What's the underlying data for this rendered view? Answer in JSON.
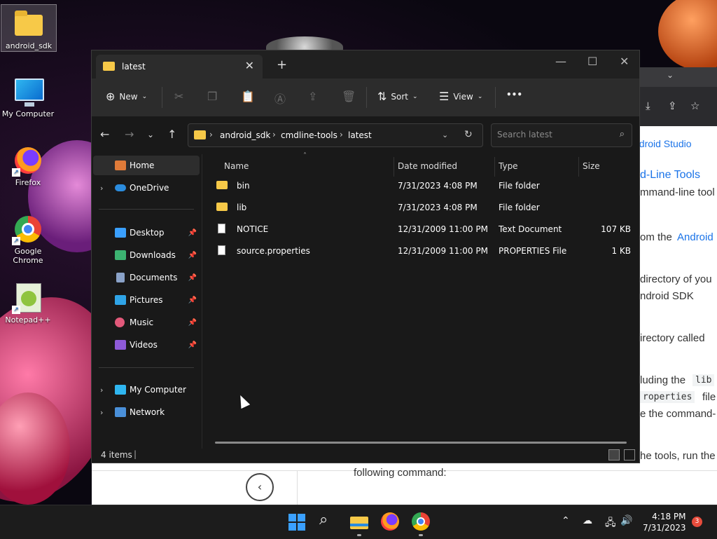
{
  "desktop": {
    "icons": [
      {
        "label": "android_sdk"
      },
      {
        "label": "My Computer"
      },
      {
        "label": "Firefox"
      },
      {
        "label": "Google Chrome"
      },
      {
        "label": "Notepad++"
      }
    ]
  },
  "browser": {
    "lines": [
      "ndroid Studio",
      "d-Line Tools",
      "mmand-line tool",
      "om the ",
      "Android",
      "directory of you",
      "ndroid SDK",
      "irectory called",
      "luding the",
      "lib",
      "roperties",
      "file",
      "e the command-",
      "he tools, run the",
      "following command:"
    ]
  },
  "explorer": {
    "tab_title": "latest",
    "new_tab": "+",
    "toolbar": {
      "new_label": "New",
      "sort_label": "Sort",
      "view_label": "View",
      "more_label": "•••"
    },
    "breadcrumb": [
      "android_sdk",
      "cmdline-tools",
      "latest"
    ],
    "search_placeholder": "Search latest",
    "nav": {
      "home": "Home",
      "onedrive": "OneDrive",
      "desktop": "Desktop",
      "downloads": "Downloads",
      "documents": "Documents",
      "pictures": "Pictures",
      "music": "Music",
      "videos": "Videos",
      "my_computer": "My Computer",
      "network": "Network"
    },
    "columns": {
      "name": "Name",
      "date": "Date modified",
      "type": "Type",
      "size": "Size"
    },
    "files": [
      {
        "name": "bin",
        "date": "7/31/2023 4:08 PM",
        "type": "File folder",
        "size": "",
        "icon": "folder-icon"
      },
      {
        "name": "lib",
        "date": "7/31/2023 4:08 PM",
        "type": "File folder",
        "size": "",
        "icon": "folder-icon"
      },
      {
        "name": "NOTICE",
        "date": "12/31/2009 11:00 PM",
        "type": "Text Document",
        "size": "107 KB",
        "icon": "document-icon"
      },
      {
        "name": "source.properties",
        "date": "12/31/2009 11:00 PM",
        "type": "PROPERTIES File",
        "size": "1 KB",
        "icon": "document-icon"
      }
    ],
    "status": "4 items"
  },
  "taskbar": {
    "time": "4:18 PM",
    "date": "7/31/2023",
    "notifications": "3"
  },
  "colors": {
    "accent": "#3aa0ff",
    "folder": "#f7c948",
    "link": "#1a73e8"
  }
}
